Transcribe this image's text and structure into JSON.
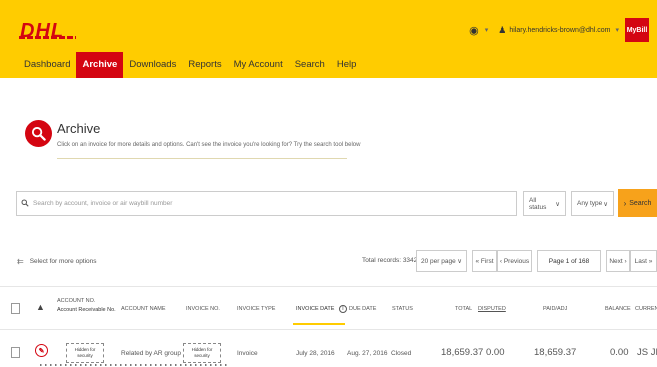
{
  "header": {
    "logo": "DHL",
    "user_email": "hilary.hendricks-brown@dhl.com",
    "mybill_label": "MyBill"
  },
  "nav": {
    "items": [
      "Dashboard",
      "Archive",
      "Downloads",
      "Reports",
      "My Account",
      "Search",
      "Help"
    ],
    "active": "Archive"
  },
  "archive": {
    "title": "Archive",
    "description": "Click on an invoice for more details and options. Can't see the invoice you're looking for? Try the search tool below"
  },
  "search": {
    "placeholder": "Search by account, invoice or air waybill number",
    "status_filter": "All status",
    "type_filter": "Any type",
    "button_label": "Search"
  },
  "toolbar": {
    "filter_label": "Select for more options",
    "total_records": "Total records: 3342",
    "per_page": "20 per page",
    "first": "« First",
    "previous": "‹ Previous",
    "page_indicator": "Page 1 of 168",
    "next": "Next ›",
    "last": "Last »"
  },
  "table": {
    "columns": {
      "account_no": "Account No.",
      "account_receivable": "Account Receivable No.",
      "account_name": "Account Name",
      "invoice_no": "Invoice No.",
      "invoice_type": "Invoice Type",
      "invoice_date": "Invoice Date",
      "due_date": "Due Date",
      "status": "Status",
      "total": "Total",
      "disputed": "Disputed",
      "paid_adj": "Paid/Adj",
      "balance": "Balance",
      "currency": "Currenc"
    },
    "rows": [
      {
        "account_no": "Hidden for security",
        "account_name": "Related by AR group",
        "invoice_no": "Hidden for security",
        "invoice_type": "Invoice",
        "invoice_date": "July 28, 2016",
        "due_date": "Aug. 27, 2016",
        "status": "Closed",
        "total": "18,659.37",
        "disputed": "0.00",
        "paid_adj": "18,659.37",
        "balance": "0.00",
        "currency": "JS JMD"
      }
    ]
  },
  "colors": {
    "brand_yellow": "#ffcc00",
    "brand_red": "#d40511",
    "search_orange": "#f7a21b"
  },
  "icons": [
    "eye-icon",
    "user-icon",
    "search-icon",
    "filter-icon",
    "download-icon",
    "pdf-icon",
    "info-icon"
  ]
}
